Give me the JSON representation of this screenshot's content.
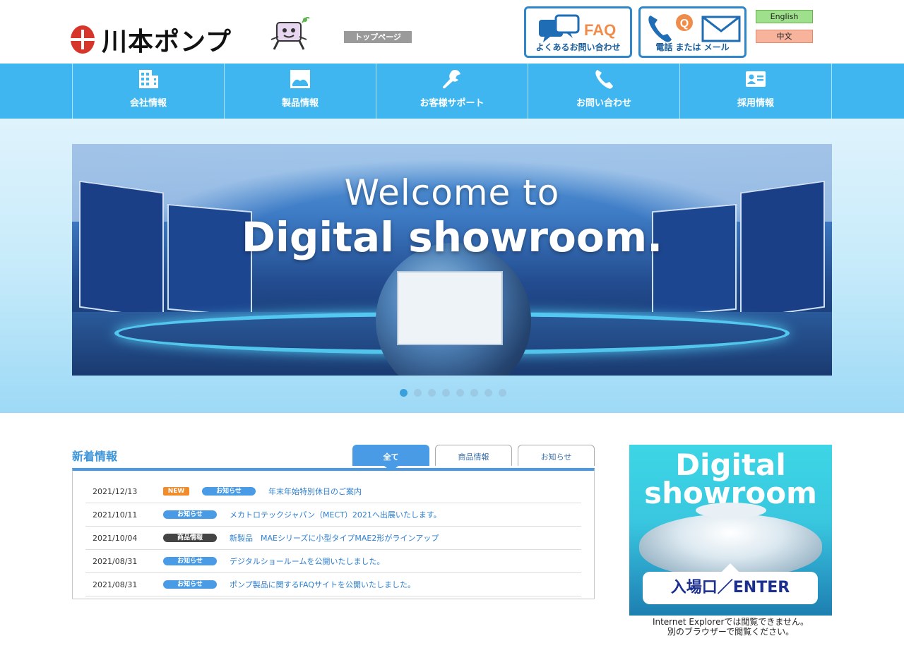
{
  "header": {
    "logo_text": "川本ポンプ",
    "top_page_label": "トップページ",
    "faq": {
      "title": "FAQ",
      "subtitle": "よくあるお問い合わせ"
    },
    "contact": {
      "subtitle": "電話 または メール"
    },
    "languages": {
      "english": "English",
      "chinese": "中文"
    }
  },
  "nav": {
    "items": [
      {
        "label": "会社情報",
        "icon": "building-icon"
      },
      {
        "label": "製品情報",
        "icon": "product-icon"
      },
      {
        "label": "お客様サポート",
        "icon": "wrench-icon"
      },
      {
        "label": "お問い合わせ",
        "icon": "phone-icon"
      },
      {
        "label": "採用情報",
        "icon": "id-card-icon"
      }
    ]
  },
  "hero": {
    "title_line1": "Welcome to",
    "title_line2": "Digital showroom.",
    "slide_count": 8,
    "active_slide": 1
  },
  "news": {
    "title": "新着情報",
    "tabs": [
      {
        "label": "全て",
        "active": true
      },
      {
        "label": "商品情報",
        "active": false
      },
      {
        "label": "お知らせ",
        "active": false
      }
    ],
    "rows": [
      {
        "date": "2021/12/13",
        "new": "NEW",
        "category": "お知らせ",
        "type": "info",
        "text": "年末年始特別休日のご案内"
      },
      {
        "date": "2021/10/11",
        "new": "",
        "category": "お知らせ",
        "type": "info",
        "text": "メカトロテックジャパン（MECT）2021へ出展いたします。"
      },
      {
        "date": "2021/10/04",
        "new": "",
        "category": "商品情報",
        "type": "product",
        "text": "新製品　MAEシリーズに小型タイプMAE2形がラインアップ"
      },
      {
        "date": "2021/08/31",
        "new": "",
        "category": "お知らせ",
        "type": "info",
        "text": "デジタルショールームを公開いたしました。"
      },
      {
        "date": "2021/08/31",
        "new": "",
        "category": "お知らせ",
        "type": "info",
        "text": "ポンプ製品に関するFAQサイトを公開いたしました。"
      }
    ]
  },
  "side_banner": {
    "title_line1": "Digital",
    "title_line2": "showroom",
    "enter_label": "入場口／ENTER",
    "note_line1": "Internet Explorerでは閲覧できません。",
    "note_line2": "別のブラウザーで閲覧ください。"
  },
  "colors": {
    "nav_bg": "#3fb6f0",
    "accent_blue": "#4a9be6",
    "logo_red": "#d8352a",
    "faq_orange": "#f08c4a",
    "new_badge": "#f08c2c"
  }
}
